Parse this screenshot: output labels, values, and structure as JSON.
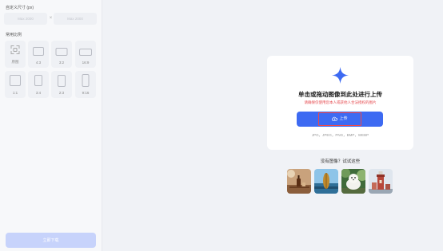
{
  "left_panel": {
    "custom_size_title": "自定义尺寸 (px)",
    "width_placeholder": "Max 2000",
    "height_placeholder": "Max 2000",
    "separator": "×",
    "common_ratio_title": "常用比例",
    "ratios": [
      {
        "label": "原图"
      },
      {
        "label": "4:3"
      },
      {
        "label": "3:2"
      },
      {
        "label": "16:9"
      },
      {
        "label": "1:1"
      },
      {
        "label": "3:4"
      },
      {
        "label": "2:3"
      },
      {
        "label": "9:16"
      }
    ],
    "download_label": "立即下载"
  },
  "upload_card": {
    "title": "单击或拖动图像到此处进行上传",
    "warning": "请确保仅使用您本人或获他人合法授权的图片",
    "upload_label": "上传",
    "formats": "JPG，JPEG，PNG，BMP，WEBP"
  },
  "samples": {
    "title": "没有图像？试试这些"
  },
  "colors": {
    "accent": "#3d6af2",
    "warning": "#e5484d",
    "download_disabled": "#c7d3fb"
  }
}
